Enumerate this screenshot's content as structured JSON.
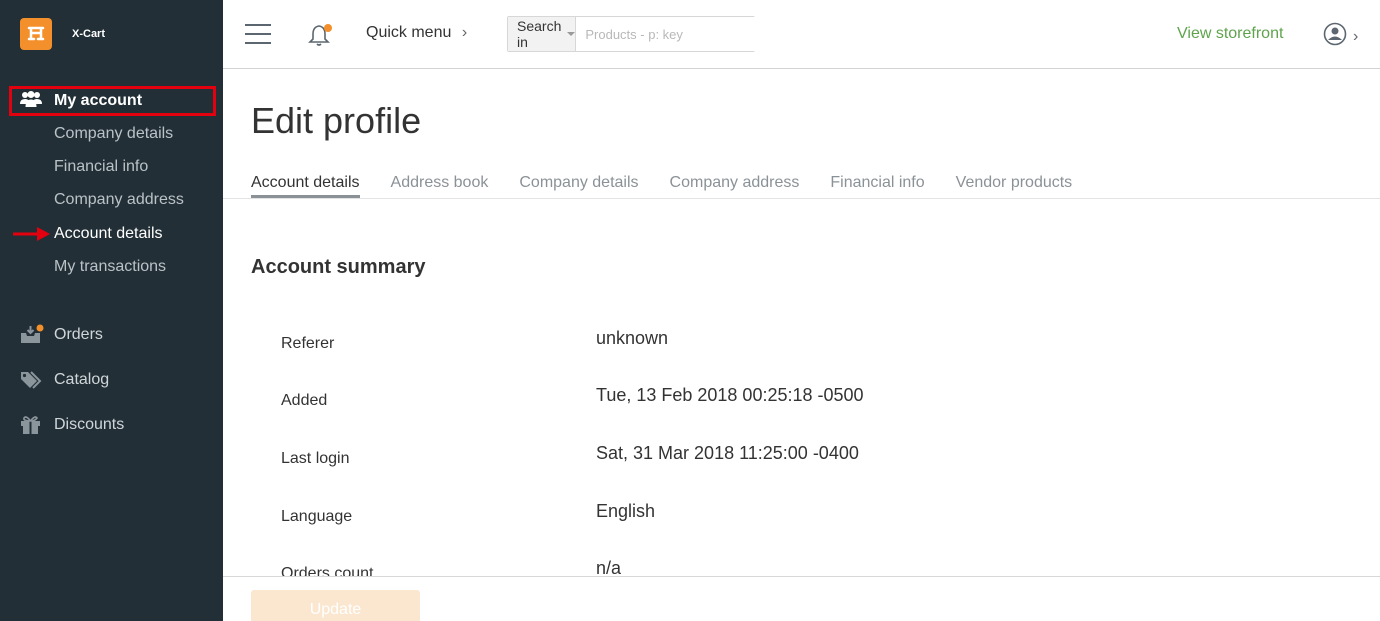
{
  "brand": {
    "name": "X-Cart",
    "accent": "#f4902b"
  },
  "sidebar": {
    "main_item": {
      "label": "My account",
      "icon": "users-icon"
    },
    "sub_items": [
      {
        "label": "Company details"
      },
      {
        "label": "Financial info"
      },
      {
        "label": "Company address"
      },
      {
        "label": "Account details",
        "active": true
      },
      {
        "label": "My transactions"
      }
    ],
    "sections": [
      {
        "label": "Orders",
        "icon": "orders-icon"
      },
      {
        "label": "Catalog",
        "icon": "tags-icon"
      },
      {
        "label": "Discounts",
        "icon": "gift-icon"
      }
    ]
  },
  "header": {
    "quick_menu": "Quick menu",
    "search": {
      "scope_label": "Search in",
      "placeholder": "Products - p: key"
    },
    "storefront_link": "View storefront"
  },
  "main": {
    "title": "Edit profile",
    "tabs": [
      {
        "label": "Account details",
        "active": true
      },
      {
        "label": "Address book"
      },
      {
        "label": "Company details"
      },
      {
        "label": "Company address"
      },
      {
        "label": "Financial info"
      },
      {
        "label": "Vendor products"
      }
    ],
    "summary": {
      "title": "Account summary",
      "fields": [
        {
          "label": "Referer",
          "value": "unknown"
        },
        {
          "label": "Added",
          "value": "Tue, 13 Feb 2018 00:25:18 -0500"
        },
        {
          "label": "Last login",
          "value": "Sat, 31 Mar 2018 11:25:00 -0400"
        },
        {
          "label": "Language",
          "value": "English"
        },
        {
          "label": "Orders count",
          "value": "n/a"
        }
      ]
    },
    "update_button": "Update"
  },
  "colors": {
    "sidebar_bg": "#232f36",
    "link_green": "#5fa34d",
    "highlight_red": "#e3000f"
  }
}
